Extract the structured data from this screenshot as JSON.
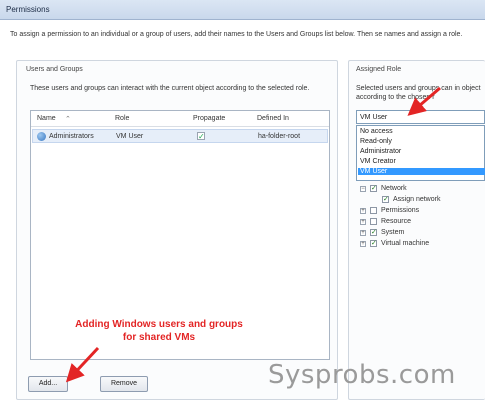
{
  "window": {
    "title": "Permissions"
  },
  "instructions": "To assign a permission to an individual or a group of users, add their names to the Users and Groups list below. Then se names and assign a role.",
  "users_and_groups": {
    "title": "Users and Groups",
    "description": "These users and groups can interact with the current object according to the selected role.",
    "columns": [
      "Name",
      "Role",
      "Propagate",
      "Defined In"
    ],
    "rows": [
      {
        "name": "Administrators",
        "role": "VM User",
        "propagate": true,
        "defined_in": "ha-folder-root"
      }
    ],
    "buttons": {
      "add": "Add...",
      "remove": "Remove"
    }
  },
  "assigned_role": {
    "title": "Assigned Role",
    "description": "Selected users and groups can in object according to the chosen r",
    "selected": "VM User",
    "options": [
      "No access",
      "Read-only",
      "Administrator",
      "VM Creator",
      "VM User"
    ],
    "privileges": [
      {
        "label": "Network",
        "checked": true,
        "expanded": true,
        "level": 1
      },
      {
        "label": "Assign network",
        "checked": true,
        "expanded": false,
        "level": 2
      },
      {
        "label": "Permissions",
        "checked": false,
        "expanded": false,
        "level": 1
      },
      {
        "label": "Resource",
        "checked": false,
        "expanded": false,
        "level": 1
      },
      {
        "label": "System",
        "checked": true,
        "expanded": false,
        "level": 1
      },
      {
        "label": "Virtual machine",
        "checked": true,
        "expanded": false,
        "level": 1
      }
    ]
  },
  "annotation": {
    "line1": "Adding Windows users and groups",
    "line2": "for shared VMs"
  },
  "watermark": "Sysprobs.com",
  "colors": {
    "annotation": "#e32525",
    "selection": "#3399ff"
  }
}
